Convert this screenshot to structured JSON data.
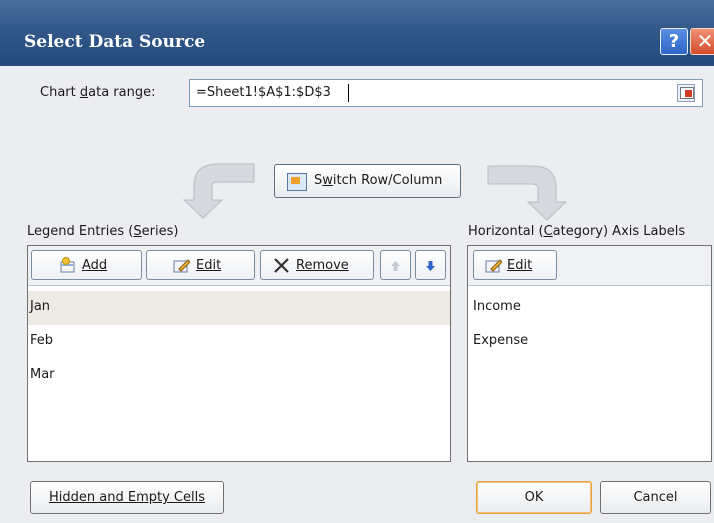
{
  "window": {
    "title": "Select Data Source",
    "help_label": "?",
    "close_label": "✕"
  },
  "range": {
    "label_prefix": "Chart ",
    "label_mnemonic": "d",
    "label_suffix": "ata range:",
    "value": "=Sheet1!$A$1:$D$3"
  },
  "switch": {
    "label_prefix": "S",
    "label_mnemonic": "w",
    "label_suffix": "itch Row/Column"
  },
  "legend": {
    "label_prefix": "Legend Entries (",
    "label_mnemonic": "S",
    "label_suffix": "eries)",
    "add_label": "Add",
    "edit_label": "Edit",
    "remove_label": "Remove",
    "items": [
      "Jan",
      "Feb",
      "Mar"
    ]
  },
  "axis": {
    "label_prefix": "Horizontal (",
    "label_mnemonic": "C",
    "label_suffix": "ategory) Axis Labels",
    "edit_label": "Edit",
    "items": [
      "Income",
      "Expense"
    ]
  },
  "footer": {
    "hidden_label": "Hidden and Empty Cells",
    "ok_label": "OK",
    "cancel_label": "Cancel"
  },
  "colors": {
    "title_bar": "#32588a",
    "ok_focus": "#e6a23c",
    "selected_row": "#ede9e3"
  },
  "icons": {
    "help": "help-icon",
    "close": "close-icon",
    "range_collapse": "range-collapse-icon",
    "switch": "switch-row-column-icon",
    "add": "add-icon",
    "edit": "edit-icon",
    "remove": "remove-icon",
    "move_up": "move-up-icon",
    "move_down": "move-down-icon"
  }
}
